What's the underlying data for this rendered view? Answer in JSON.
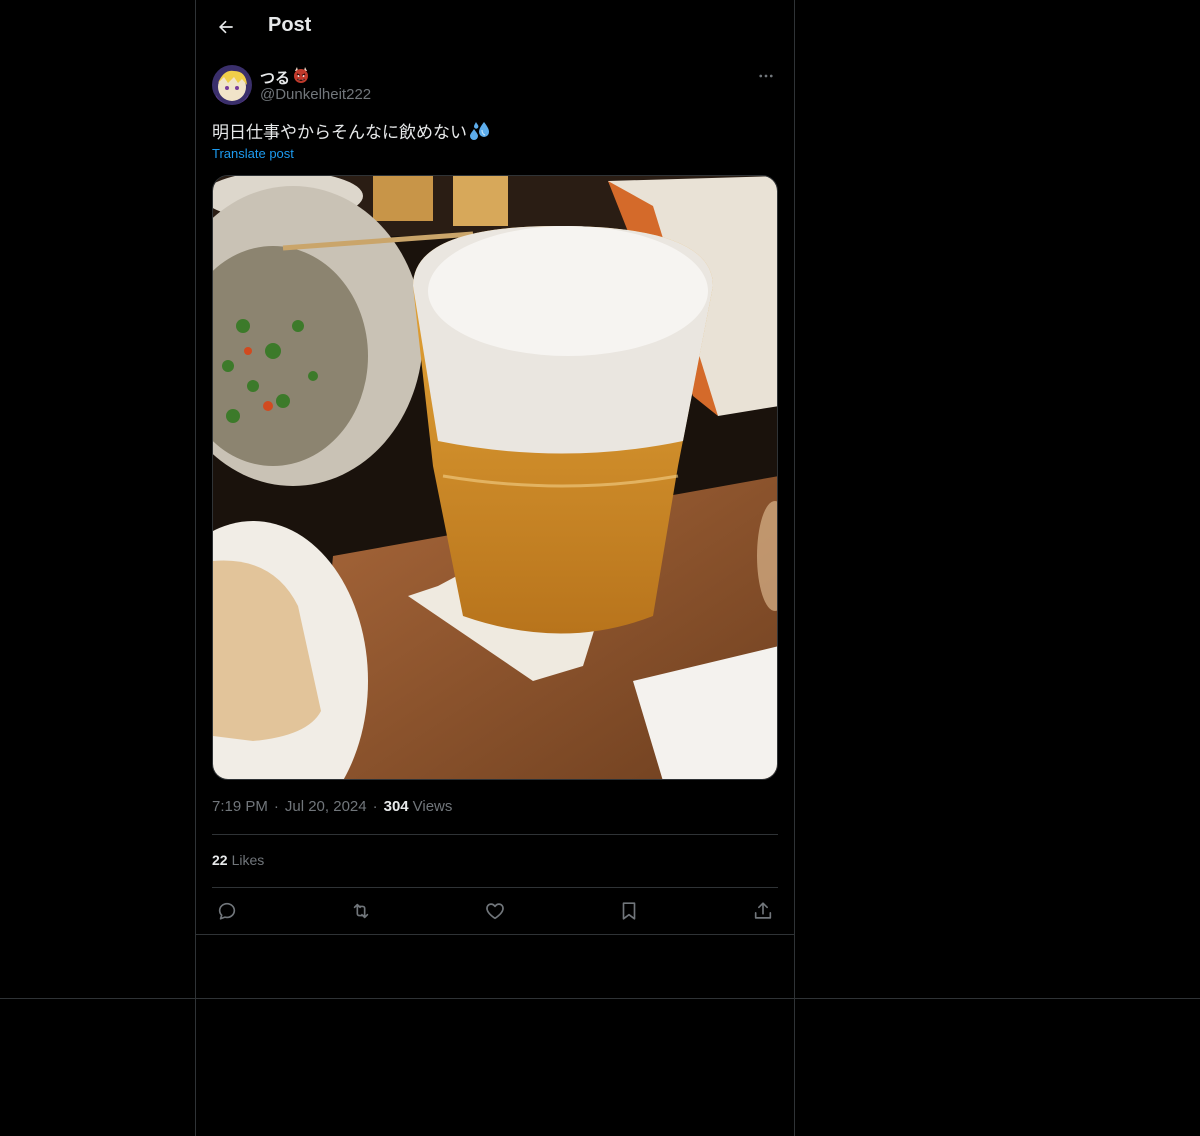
{
  "header": {
    "title": "Post"
  },
  "author": {
    "display_name": "つる",
    "handle": "@Dunkelheit222"
  },
  "post": {
    "text": "明日仕事やからそんなに飲めない",
    "translate_label": "Translate post",
    "time": "7:19 PM",
    "date": "Jul 20, 2024",
    "views_count": "304",
    "views_label": "Views",
    "likes_count": "22",
    "likes_label": "Likes"
  },
  "icons": {
    "back": "back-arrow-icon",
    "more": "more-icon",
    "reply": "reply-icon",
    "repost": "repost-icon",
    "like": "like-icon",
    "bookmark": "bookmark-icon",
    "share": "share-icon"
  },
  "colors": {
    "background": "#000000",
    "text": "#e7e9ea",
    "muted": "#71767b",
    "link": "#1d9bf0",
    "border": "#2f3336"
  }
}
